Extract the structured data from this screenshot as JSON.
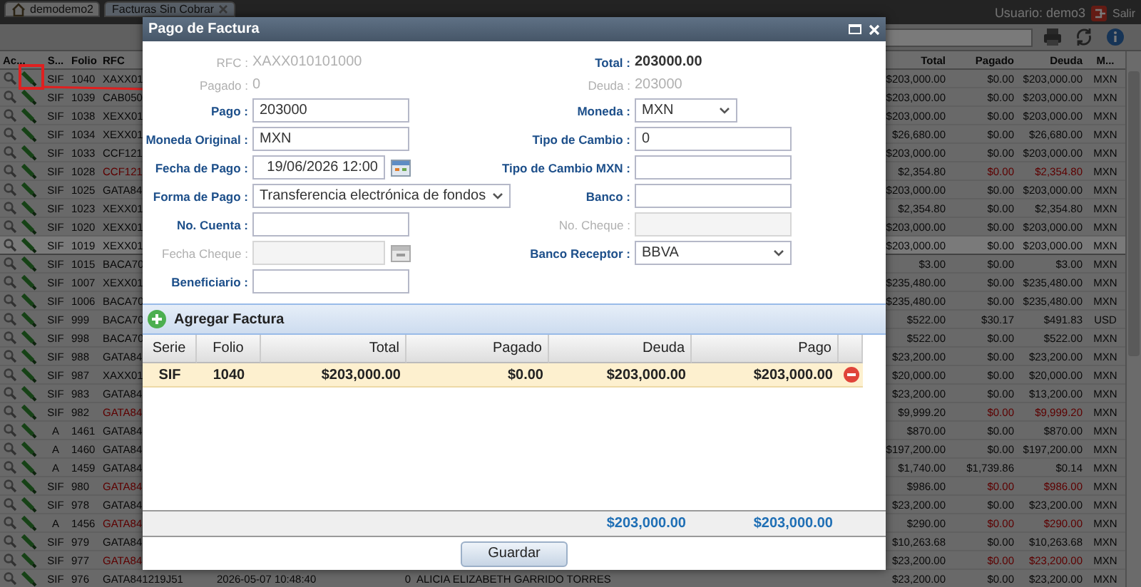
{
  "app": {
    "tabs": [
      {
        "label": "demodemo2",
        "kind": "home",
        "selected": false
      },
      {
        "label": "Facturas Sin Cobrar",
        "kind": "closable",
        "selected": true
      }
    ],
    "user": "Usuario: demo3",
    "logout": "Salir"
  },
  "table": {
    "columns": [
      "Ac...",
      "S...",
      "Folio",
      "RFC",
      "Total",
      "Pagado",
      "Deuda",
      "M..."
    ],
    "rows": [
      {
        "series": "SIF",
        "folio": "1040",
        "rfc": "XAXX01",
        "total": "$203,000.00",
        "pagado": "$0.00",
        "deuda": "$203,000.00",
        "currency": "MXN",
        "overdue": false,
        "selected": false
      },
      {
        "series": "SIF",
        "folio": "1039",
        "rfc": "CAB050",
        "total": "$203,000.00",
        "pagado": "$0.00",
        "deuda": "$203,000.00",
        "currency": "MXN",
        "overdue": false,
        "selected": false
      },
      {
        "series": "SIF",
        "folio": "1038",
        "rfc": "XEXX01",
        "total": "$203,000.00",
        "pagado": "$0.00",
        "deuda": "$203,000.00",
        "currency": "MXN",
        "overdue": false,
        "selected": false
      },
      {
        "series": "SIF",
        "folio": "1034",
        "rfc": "XEXX01",
        "total": "$26,680.00",
        "pagado": "$0.00",
        "deuda": "$26,680.00",
        "currency": "MXN",
        "overdue": false,
        "selected": false
      },
      {
        "series": "SIF",
        "folio": "1033",
        "rfc": "CCF121",
        "total": "$203,000.00",
        "pagado": "$0.00",
        "deuda": "$203,000.00",
        "currency": "MXN",
        "overdue": false,
        "selected": false
      },
      {
        "series": "SIF",
        "folio": "1028",
        "rfc": "CCF121",
        "total": "$2,354.80",
        "pagado": "$0.00",
        "deuda": "$2,354.80",
        "currency": "MXN",
        "overdue": true,
        "selected": false
      },
      {
        "series": "SIF",
        "folio": "1025",
        "rfc": "GATA84",
        "total": "$203,000.00",
        "pagado": "$0.00",
        "deuda": "$203,000.00",
        "currency": "MXN",
        "overdue": false,
        "selected": false
      },
      {
        "series": "SIF",
        "folio": "1023",
        "rfc": "XEXX01",
        "total": "$2,354.80",
        "pagado": "$0.00",
        "deuda": "$2,354.80",
        "currency": "MXN",
        "overdue": false,
        "selected": false
      },
      {
        "series": "SIF",
        "folio": "1020",
        "rfc": "XEXX01",
        "total": "$203,000.00",
        "pagado": "$0.00",
        "deuda": "$203,000.00",
        "currency": "MXN",
        "overdue": false,
        "selected": false
      },
      {
        "series": "SIF",
        "folio": "1019",
        "rfc": "XEXX01",
        "total": "$203,000.00",
        "pagado": "$0.00",
        "deuda": "$203,000.00",
        "currency": "MXN",
        "overdue": false,
        "selected": true
      },
      {
        "series": "SIF",
        "folio": "1015",
        "rfc": "BACA70",
        "total": "$3.00",
        "pagado": "$0.00",
        "deuda": "$3.00",
        "currency": "MXN",
        "overdue": false,
        "selected": false
      },
      {
        "series": "SIF",
        "folio": "1007",
        "rfc": "XEXX01",
        "total": "$235,480.00",
        "pagado": "$0.00",
        "deuda": "$235,480.00",
        "currency": "MXN",
        "overdue": false,
        "selected": false
      },
      {
        "series": "SIF",
        "folio": "1006",
        "rfc": "BACA70",
        "total": "$235,480.00",
        "pagado": "$0.00",
        "deuda": "$235,480.00",
        "currency": "MXN",
        "overdue": false,
        "selected": false
      },
      {
        "series": "SIF",
        "folio": "999",
        "rfc": "BACA70",
        "total": "$522.00",
        "pagado": "$30.17",
        "deuda": "$491.83",
        "currency": "USD",
        "overdue": false,
        "selected": false
      },
      {
        "series": "SIF",
        "folio": "998",
        "rfc": "BACA70",
        "total": "$522.00",
        "pagado": "$0.00",
        "deuda": "$522.00",
        "currency": "MXN",
        "overdue": false,
        "selected": false
      },
      {
        "series": "SIF",
        "folio": "988",
        "rfc": "GATA84",
        "total": "$23,200.00",
        "pagado": "$0.00",
        "deuda": "$23,200.00",
        "currency": "MXN",
        "overdue": false,
        "selected": false
      },
      {
        "series": "SIF",
        "folio": "987",
        "rfc": "XAXX01",
        "total": "$20,000.00",
        "pagado": "$0.00",
        "deuda": "$20,000.00",
        "currency": "MXN",
        "overdue": false,
        "selected": false
      },
      {
        "series": "SIF",
        "folio": "983",
        "rfc": "GATA84",
        "total": "$23,200.00",
        "pagado": "$0.00",
        "deuda": "$13,200.00",
        "currency": "MXN",
        "overdue": false,
        "selected": false
      },
      {
        "series": "SIF",
        "folio": "982",
        "rfc": "GATA84",
        "total": "$9,999.20",
        "pagado": "$0.00",
        "deuda": "$9,999.20",
        "currency": "MXN",
        "overdue": true,
        "selected": false
      },
      {
        "series": "A",
        "folio": "1461",
        "rfc": "GATA84",
        "total": "$870.00",
        "pagado": "$0.00",
        "deuda": "$870.00",
        "currency": "MXN",
        "overdue": false,
        "selected": false
      },
      {
        "series": "A",
        "folio": "1460",
        "rfc": "GATA84",
        "total": "$197,200.00",
        "pagado": "$0.00",
        "deuda": "$197,200.00",
        "currency": "MXN",
        "overdue": false,
        "selected": false
      },
      {
        "series": "A",
        "folio": "1459",
        "rfc": "GATA84",
        "total": "$1,740.00",
        "pagado": "$1,739.86",
        "deuda": "$0.14",
        "currency": "MXN",
        "overdue": false,
        "selected": false
      },
      {
        "series": "SIF",
        "folio": "980",
        "rfc": "GATA84",
        "total": "$986.00",
        "pagado": "$0.00",
        "deuda": "$986.00",
        "currency": "MXN",
        "overdue": true,
        "selected": false
      },
      {
        "series": "SIF",
        "folio": "978",
        "rfc": "GATA84",
        "total": "$23,200.00",
        "pagado": "$0.00",
        "deuda": "$23,200.00",
        "currency": "MXN",
        "overdue": false,
        "selected": false
      },
      {
        "series": "A",
        "folio": "1456",
        "rfc": "GATA84",
        "total": "$290.00",
        "pagado": "$0.00",
        "deuda": "$290.00",
        "currency": "MXN",
        "overdue": true,
        "selected": false
      },
      {
        "series": "SIF",
        "folio": "979",
        "rfc": "GATA84",
        "total": "$10,263.68",
        "pagado": "$0.00",
        "deuda": "$10,263.68",
        "currency": "MXN",
        "overdue": false,
        "selected": false
      },
      {
        "series": "SIF",
        "folio": "977",
        "rfc": "GATA84",
        "total": "$23,200.00",
        "pagado": "$0.00",
        "deuda": "$23,200.00",
        "currency": "MXN",
        "overdue": true,
        "selected": false
      },
      {
        "series": "SIF",
        "folio": "976",
        "rfc": "GATA841219J51",
        "date": "2026-05-07 10:48:40",
        "column_6": "0",
        "client": "ALICIA ELIZABETH GARRIDO TORRES",
        "total": "$23,200.00",
        "pagado": "$0.00",
        "deuda": "$23,200.00",
        "currency": "MXN",
        "overdue": false,
        "selected": false
      }
    ]
  },
  "dialog": {
    "title": "Pago de Factura",
    "form": [
      [
        {
          "label": "RFC :",
          "kind": "text",
          "value": "XAXX010101000",
          "disabled": true
        },
        {
          "label": "Total :",
          "kind": "text",
          "value": "203000.00",
          "disabled": false
        }
      ],
      [
        {
          "label": "Pagado :",
          "kind": "text",
          "value": "0",
          "disabled": true
        },
        {
          "label": "Deuda :",
          "kind": "text",
          "value": "203000",
          "disabled": true
        }
      ],
      [
        {
          "label": "Pago :",
          "kind": "input",
          "value": "203000",
          "disabled": false
        },
        {
          "label": "Moneda :",
          "kind": "select",
          "value": "MXN",
          "disabled": false
        }
      ],
      [
        {
          "label": "Moneda Original :",
          "kind": "input",
          "value": "MXN",
          "disabled": false
        },
        {
          "label": "Tipo de Cambio :",
          "kind": "input",
          "value": "0",
          "disabled": false
        }
      ],
      [
        {
          "label": "Fecha de Pago :",
          "kind": "date",
          "value": "19/06/2026 12:00",
          "disabled": false
        },
        {
          "label": "Tipo de Cambio MXN :",
          "kind": "input",
          "disabled": false
        }
      ],
      [
        {
          "label": "Forma de Pago :",
          "kind": "select",
          "value": "Transferencia electrónica de fondos",
          "disabled": false
        },
        {
          "label": "Banco :",
          "kind": "input",
          "disabled": false
        }
      ],
      [
        {
          "label": "No. Cuenta :",
          "kind": "input",
          "disabled": false
        },
        {
          "label": "No. Cheque :",
          "kind": "input",
          "disabled": true
        }
      ],
      [
        {
          "label": "Fecha Cheque :",
          "kind": "date",
          "disabled": true
        },
        {
          "label": "Banco Receptor :",
          "kind": "select",
          "value": "BBVA",
          "disabled": false
        }
      ],
      [
        {
          "label": "Beneficiario :",
          "kind": "input",
          "disabled": false
        }
      ]
    ],
    "invoices": {
      "title": "Agregar Factura",
      "columns": [
        "Serie",
        "Folio",
        "Total",
        "Pagado",
        "Deuda",
        "Pago"
      ],
      "rows": [
        {
          "cells": [
            "SIF",
            "1040",
            "$203,000.00",
            "$0.00",
            "$203,000.00",
            "$203,000.00"
          ],
          "selected": true
        }
      ],
      "totals": {
        "deuda": "$203,000.00",
        "pago": "$203,000.00"
      }
    },
    "save": "Guardar"
  }
}
